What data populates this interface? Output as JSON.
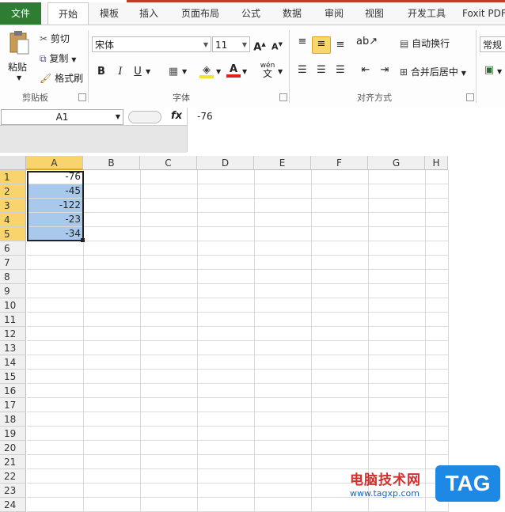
{
  "tabs": [
    "文件",
    "开始",
    "模板",
    "插入",
    "页面布局",
    "公式",
    "数据",
    "审阅",
    "视图",
    "开发工具",
    "Foxit PDF"
  ],
  "clipboard": {
    "paste": "粘贴",
    "cut": "剪切",
    "copy": "复制",
    "format_painter": "格式刷",
    "group": "剪贴板"
  },
  "font": {
    "name": "宋体",
    "size": "11",
    "bold": "B",
    "italic": "I",
    "underline": "U",
    "group": "字体",
    "grow": "A",
    "shrink": "A",
    "phonetic": "wén"
  },
  "alignment": {
    "wrap": "自动换行",
    "merge": "合并后居中",
    "group": "对齐方式"
  },
  "number": {
    "format": "常规"
  },
  "formula_bar": {
    "name_box": "A1",
    "fx": "fx",
    "value": "-76"
  },
  "columns": [
    "A",
    "B",
    "C",
    "D",
    "E",
    "F",
    "G",
    "H"
  ],
  "rows": [
    "1",
    "2",
    "3",
    "4",
    "5",
    "6",
    "7",
    "8",
    "9",
    "10",
    "11",
    "12",
    "13",
    "14",
    "15",
    "16",
    "17",
    "18",
    "19",
    "20",
    "21",
    "22",
    "23",
    "24"
  ],
  "cells_A": [
    "-76",
    "-45",
    "-122",
    "-23",
    "-34"
  ],
  "watermark": {
    "text": "电脑技术网",
    "url": "www.tagxp.com",
    "tag": "TAG"
  },
  "colors": {
    "file_tab": "#2e7d32",
    "selection": "#a8c9ec",
    "header_selected": "#f9d36b",
    "accent_red": "#c0392b"
  }
}
